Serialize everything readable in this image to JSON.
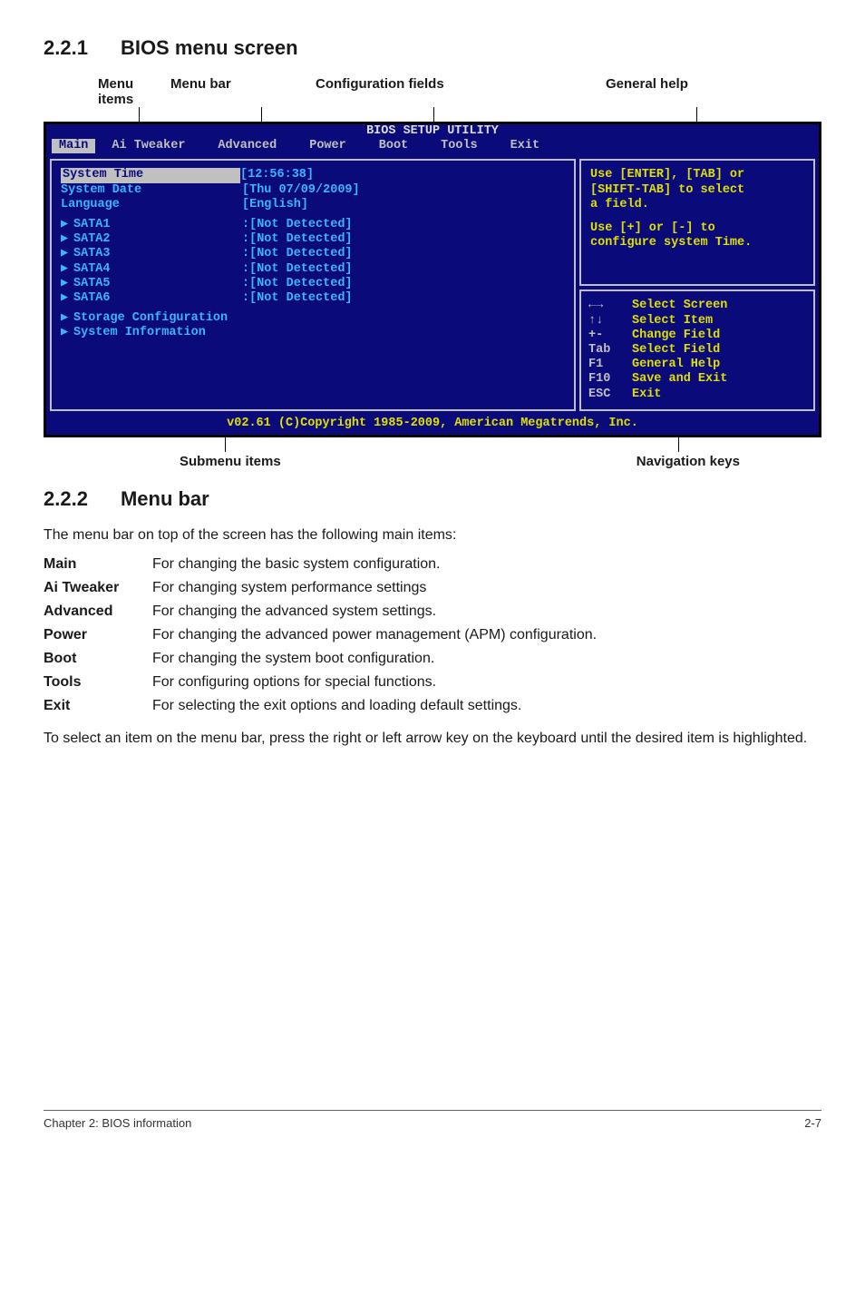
{
  "section1": {
    "num": "2.2.1",
    "title": "BIOS menu screen"
  },
  "topLabels": {
    "menuitems": "Menu items",
    "menubar": "Menu bar",
    "config": "Configuration fields",
    "general": "General help"
  },
  "bios": {
    "title": "BIOS SETUP UTILITY",
    "tabs": {
      "main": "Main",
      "aitweaker": "Ai Tweaker",
      "advanced": "Advanced",
      "power": "Power",
      "boot": "Boot",
      "tools": "Tools",
      "exit": "Exit"
    },
    "fields": {
      "systemTimeLabel": "System Time",
      "systemTimeVal": "[12:56:38]",
      "systemDateLabel": "System Date",
      "systemDateVal": "[Thu 07/09/2009]",
      "languageLabel": "Language",
      "languageVal": "[English]",
      "sata": [
        {
          "label": "SATA1",
          "val": ":[Not Detected]"
        },
        {
          "label": "SATA2",
          "val": ":[Not Detected]"
        },
        {
          "label": "SATA3",
          "val": ":[Not Detected]"
        },
        {
          "label": "SATA4",
          "val": ":[Not Detected]"
        },
        {
          "label": "SATA5",
          "val": ":[Not Detected]"
        },
        {
          "label": "SATA6",
          "val": ":[Not Detected]"
        }
      ],
      "storageConfig": "Storage Configuration",
      "systemInfo": "System Information"
    },
    "help": {
      "line1": "Use [ENTER], [TAB] or",
      "line2": "[SHIFT-TAB] to select",
      "line3": "a field.",
      "line4": "Use [+] or [-] to",
      "line5": "configure system Time."
    },
    "nav": {
      "arrowsLR": "←→",
      "arrowsLRAct": "Select Screen",
      "arrowsUD": "↑↓",
      "arrowsUDAct": "Select Item",
      "plusminus": "+-",
      "plusminusAct": "Change Field",
      "tab": "Tab",
      "tabAct": "Select Field",
      "f1": "F1",
      "f1Act": "General Help",
      "f10": "F10",
      "f10Act": "Save and Exit",
      "esc": "ESC",
      "escAct": "Exit"
    },
    "copyright": "v02.61 (C)Copyright 1985-2009, American Megatrends, Inc."
  },
  "bottomLabels": {
    "submenu": "Submenu items",
    "navkeys": "Navigation keys"
  },
  "section2": {
    "num": "2.2.2",
    "title": "Menu bar"
  },
  "para1": "The menu bar on top of the screen has the following main items:",
  "defs": {
    "main": {
      "term": "Main",
      "desc": "For changing the basic system configuration."
    },
    "aitweaker": {
      "term": "Ai Tweaker",
      "desc": "For changing system performance settings"
    },
    "advanced": {
      "term": "Advanced",
      "desc": "For changing the advanced system settings."
    },
    "power": {
      "term": "Power",
      "desc": "For changing the advanced power management (APM) configuration."
    },
    "boot": {
      "term": "Boot",
      "desc": "For changing the system boot configuration."
    },
    "tools": {
      "term": "Tools",
      "desc": "For configuring options for special functions."
    },
    "exit": {
      "term": "Exit",
      "desc": "For selecting the exit options and loading default settings."
    }
  },
  "para2": "To select an item on the menu bar, press the right or left arrow key on the keyboard until the desired item is highlighted.",
  "footer": {
    "left": "Chapter 2: BIOS information",
    "right": "2-7"
  }
}
